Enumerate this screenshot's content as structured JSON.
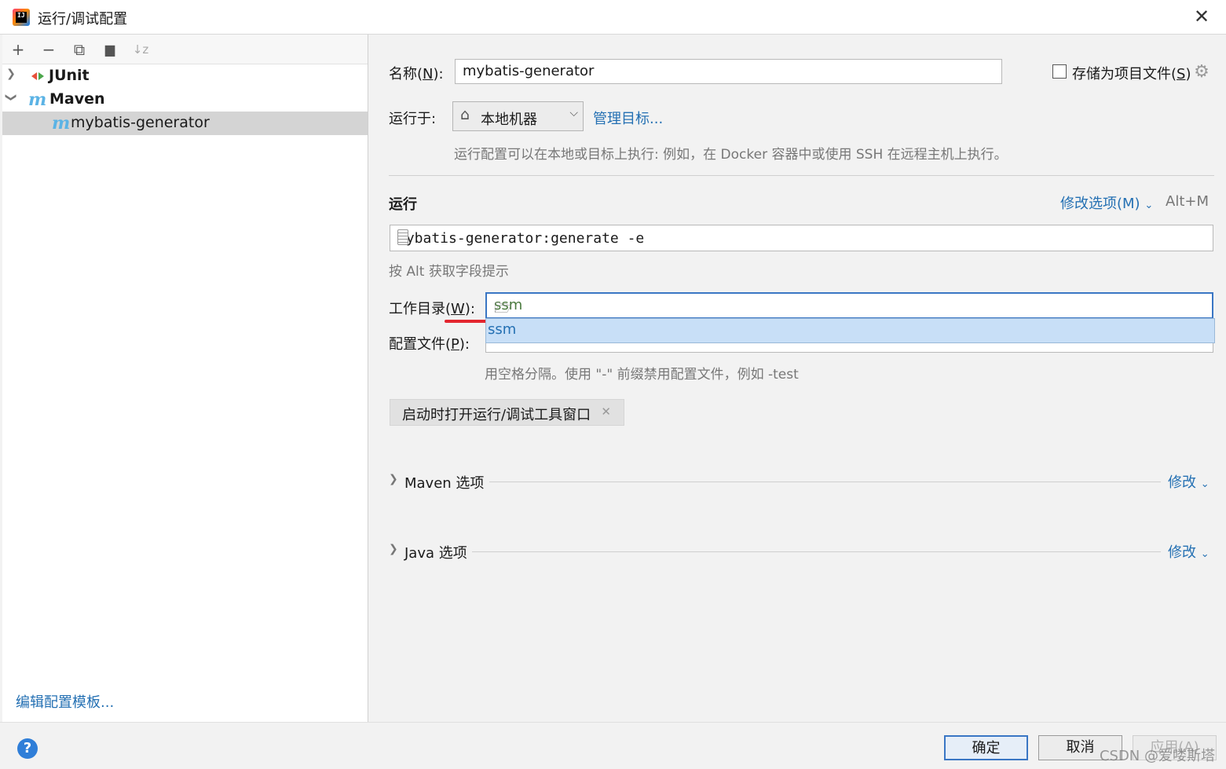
{
  "window": {
    "title": "运行/调试配置"
  },
  "toolbar": {
    "add": "+",
    "remove": "−",
    "copy": "⧉",
    "folder": "▆",
    "sort": "↓z"
  },
  "tree": {
    "items": [
      {
        "label": "JUnit",
        "expanded": false
      },
      {
        "label": "Maven",
        "expanded": true
      },
      {
        "label": "mybatis-generator",
        "selected": true
      }
    ]
  },
  "left_footer": {
    "edit_templates": "编辑配置模板..."
  },
  "form": {
    "name_label": "名称(",
    "name_mnemonic": "N",
    "name_label_end": "):",
    "name_value": "mybatis-generator",
    "store_label": "存储为项目文件(",
    "store_mnemonic": "S",
    "store_label_end": ")",
    "run_on_label": "运行于:",
    "run_on_value": "本地机器",
    "manage_targets": "管理目标...",
    "run_on_hint": "运行配置可以在本地或目标上执行: 例如，在 Docker 容器中或使用 SSH 在远程主机上执行。",
    "run_section": "运行",
    "modify_options": "修改选项(M)",
    "modify_shortcut": "Alt+M",
    "command_value": "mybatis-generator:generate -e",
    "alt_hint": "按 Alt 获取字段提示",
    "workdir_label": "工作目录(",
    "workdir_mnemonic": "W",
    "workdir_label_end": "):",
    "workdir_value": "ssm",
    "suggestion": "ssm",
    "profiles_label": "配置文件(",
    "profiles_mnemonic": "P",
    "profiles_label_end": "):",
    "profiles_hint": "用空格分隔。使用 \"-\" 前缀禁用配置文件，例如 -test",
    "tag_label": "启动时打开运行/调试工具窗口",
    "maven_section": "Maven 选项",
    "java_section": "Java 选项",
    "modify": "修改"
  },
  "buttons": {
    "ok": "确定",
    "cancel": "取消",
    "apply": "应用(A)"
  },
  "watermark": "CSDN @爱喽斯塔",
  "colors": {
    "link": "#2470b3",
    "accent": "#3a76c4",
    "selection": "#d4d4d4",
    "suggestion_bg": "#c8dff7",
    "underline_red": "#e3262f"
  },
  "icons": [
    "app-icon",
    "close-icon",
    "add-icon",
    "remove-icon",
    "copy-icon",
    "folder-add-icon",
    "sort-icon",
    "junit-icon",
    "maven-icon",
    "home-icon",
    "gear-icon",
    "browse-file-icon",
    "folder-open-icon",
    "help-icon"
  ]
}
